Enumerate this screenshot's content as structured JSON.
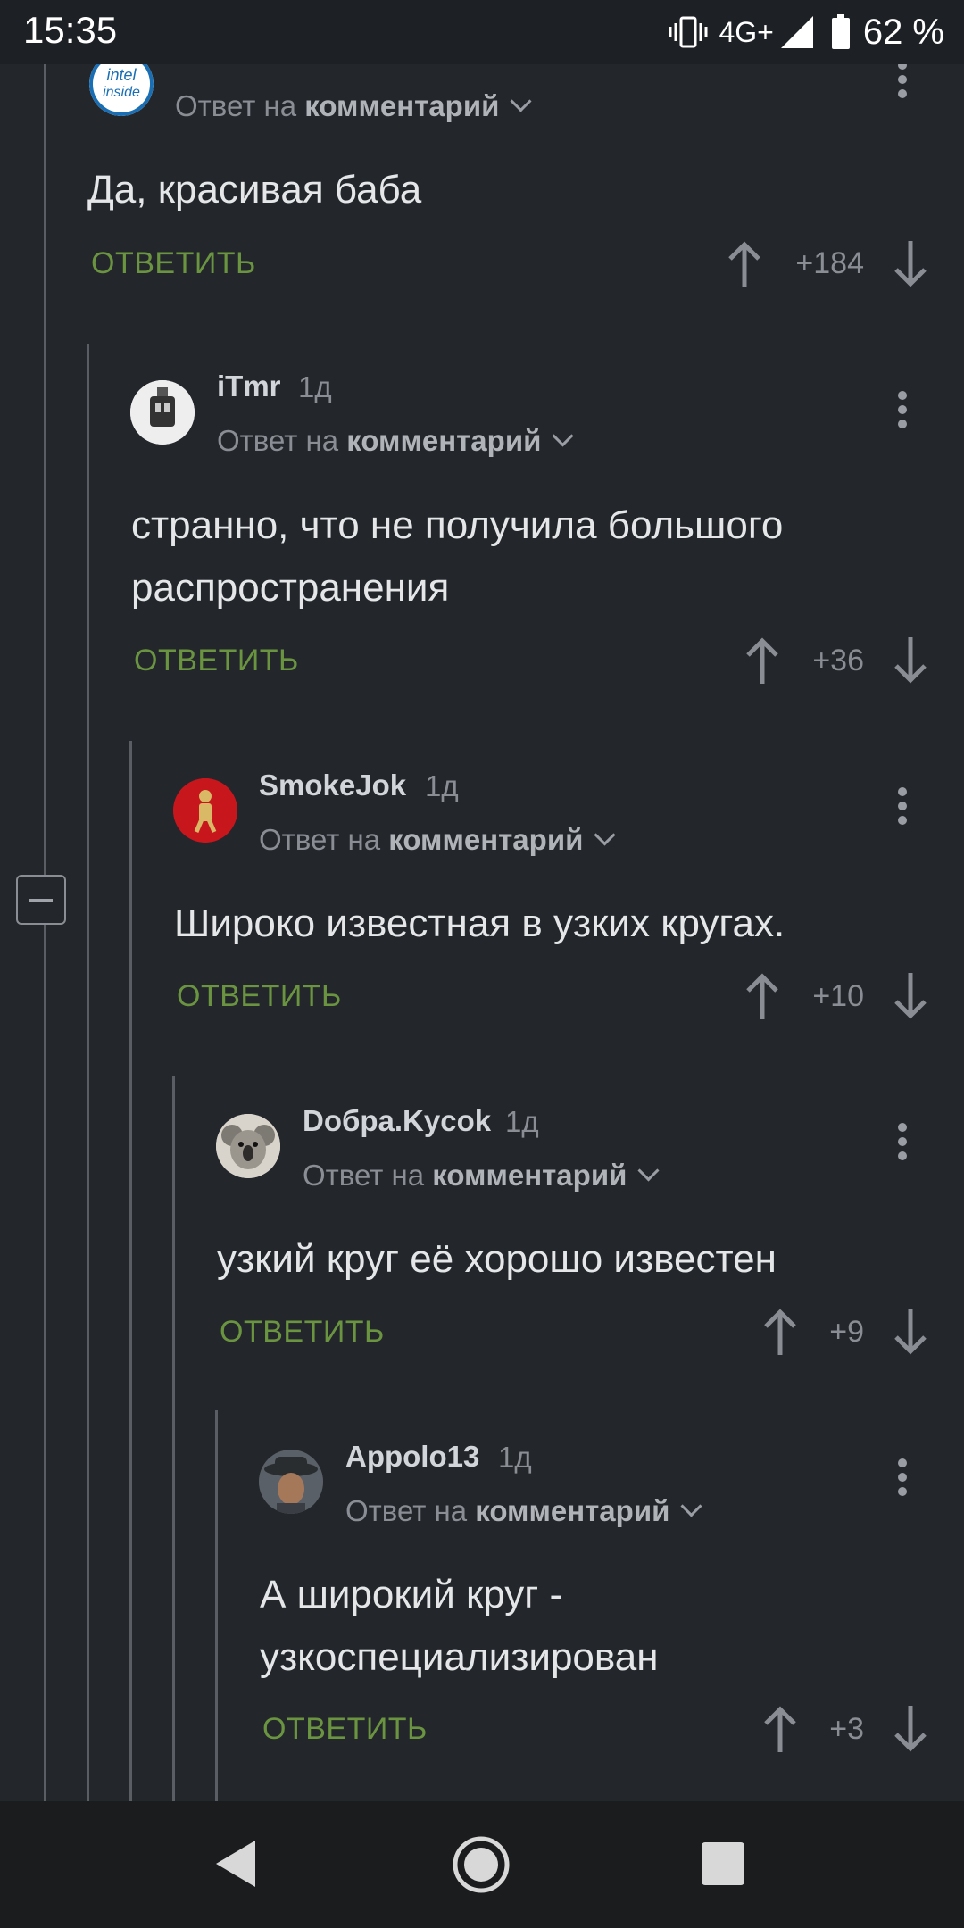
{
  "status_bar": {
    "time": "15:35",
    "network": "4G+",
    "battery": "62 %",
    "icons": [
      "vibrate-icon",
      "signal-icon",
      "battery-icon"
    ]
  },
  "reply_label": "ОТВЕТИТЬ",
  "reply_prefix": "Ответ на",
  "reply_target": "комментарий",
  "comments": [
    {
      "username": "",
      "time": "",
      "text": "Да, красивая баба",
      "score": "+184",
      "avatar": "intel-inside-avatar"
    },
    {
      "username": "iTmr",
      "time": "1д",
      "text_lines": [
        "странно, что не получила большого",
        "распространения"
      ],
      "score": "+36",
      "avatar": "robot-avatar"
    },
    {
      "username": "SmokeJok",
      "time": "1д",
      "text": "Широко известная в узких кругах.",
      "score": "+10",
      "avatar": "figure-avatar"
    },
    {
      "username": "Doбpa.Kycok",
      "time": "1д",
      "text": "узкий круг её хорошо известен",
      "score": "+9",
      "avatar": "koala-avatar"
    },
    {
      "username": "Appolo13",
      "time": "1д",
      "text_lines": [
        "А широкий круг -",
        "узкоспециализирован"
      ],
      "score": "+3",
      "avatar": "man-hat-avatar"
    }
  ],
  "colors": {
    "background": "#23272c",
    "reply": "#6b9440",
    "muted": "#8a8e94"
  }
}
